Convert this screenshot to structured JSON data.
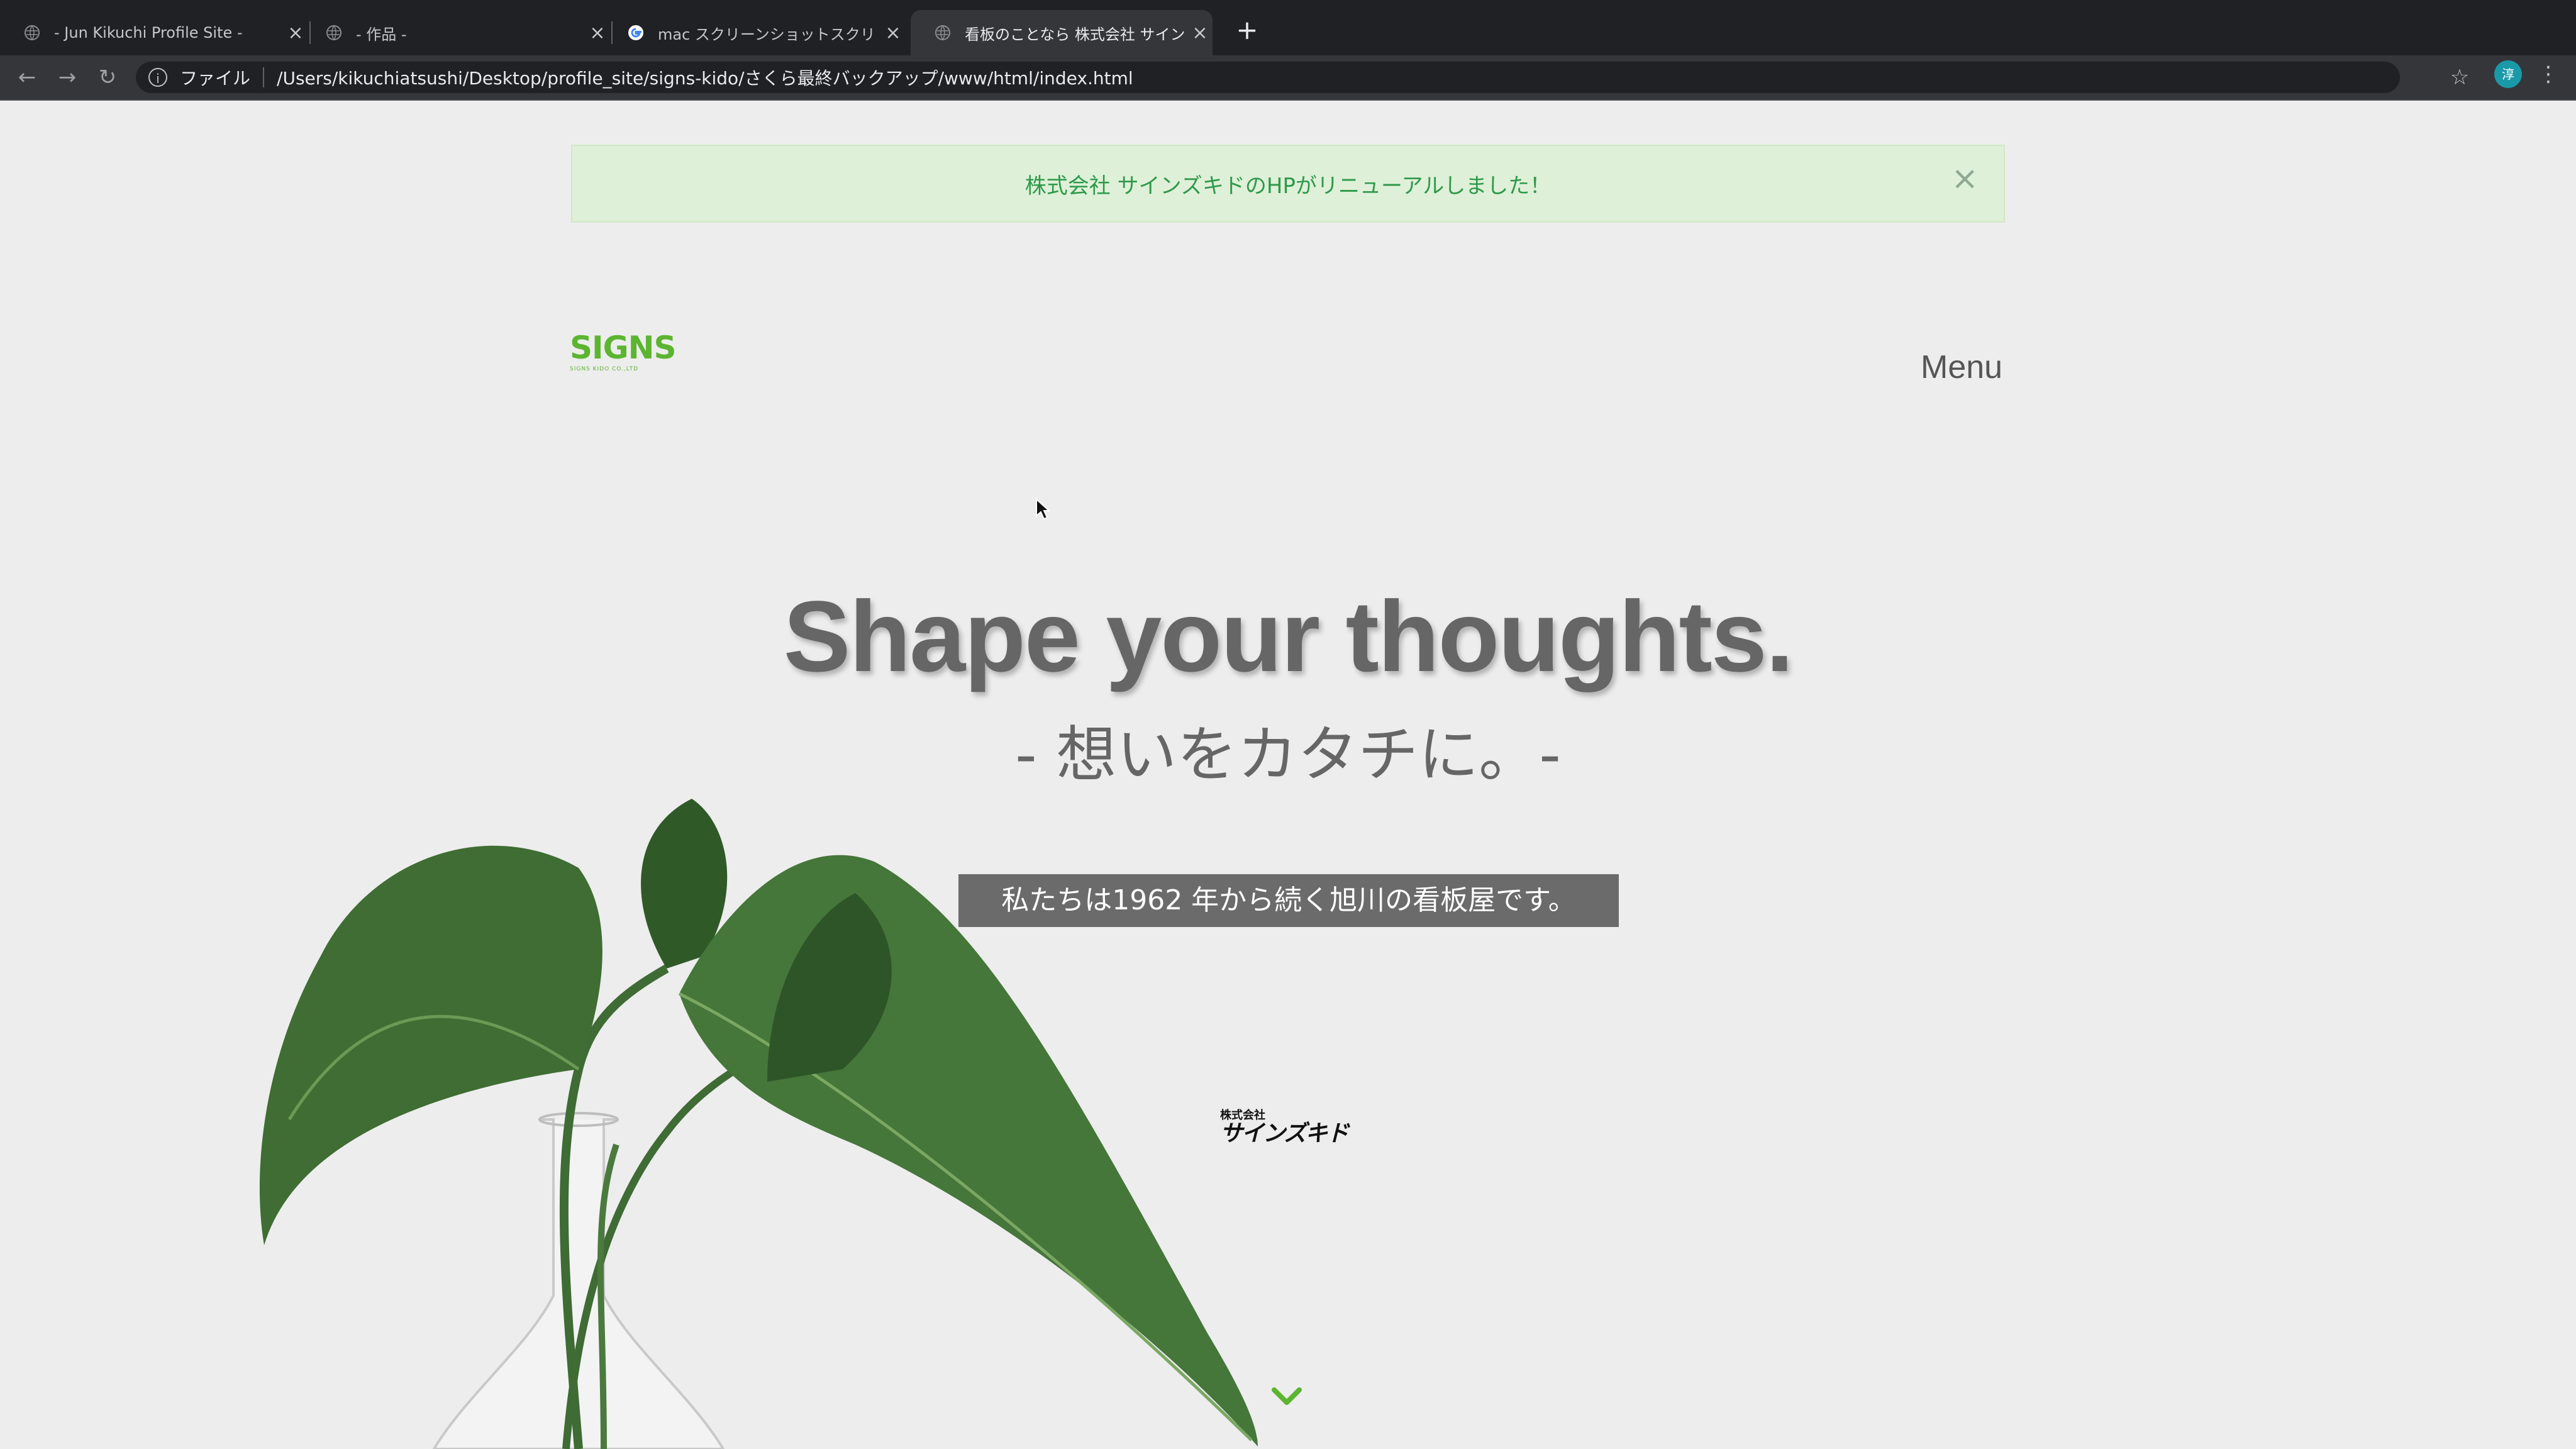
{
  "browser": {
    "tabs": [
      {
        "title": "- Jun Kikuchi Profile Site -",
        "icon": "globe-icon",
        "active": false
      },
      {
        "title": "- 作品 -",
        "icon": "globe-icon",
        "active": false
      },
      {
        "title": "mac スクリーンショットスクリ",
        "icon": "google-icon",
        "active": false
      },
      {
        "title": "看板のことなら 株式会社 サイン",
        "icon": "globe-icon",
        "active": true
      }
    ],
    "new_tab_label": "+",
    "close_glyph": "×",
    "address": {
      "scheme_label": "ファイル",
      "url": "/Users/kikuchiatsushi/Desktop/profile_site/signs-kido/さくら最終バックアップ/www/html/index.html"
    },
    "profile_initial": "淳",
    "colors": {
      "tabbar": "#202124",
      "toolbar": "#35363a",
      "profile": "#1a9aa8"
    }
  },
  "page": {
    "alert": {
      "message": "株式会社 サインズキドのHPがリニューアルしました！",
      "close": "×",
      "color": "#2d9a4a"
    },
    "logo": {
      "text": "SIGNS",
      "sub": "SIGNS KIDO CO.,LTD",
      "color": "#5cb531"
    },
    "menu_label": "Menu",
    "hero": {
      "title": "Shape your thoughts.",
      "subtitle": "- 想いをカタチに。-"
    },
    "tagline": "私たちは1962 年から続く旭川の看板屋です。",
    "company_mark": {
      "small": "株式会社",
      "big": "サインズキド"
    },
    "scroll_icon": "chevron-down-icon",
    "accent": "#5cb531"
  }
}
